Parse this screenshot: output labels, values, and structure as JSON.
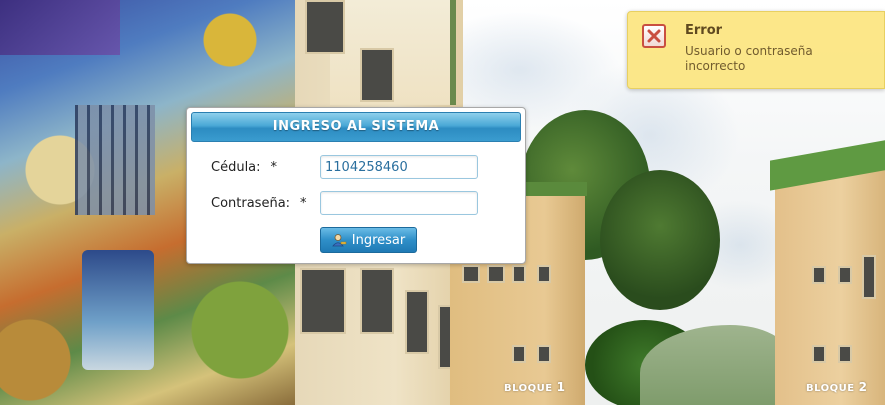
{
  "login": {
    "title": "INGRESO AL SISTEMA",
    "cedula_label": "Cédula:",
    "cedula_required": "*",
    "cedula_value": "1104258460",
    "password_label": "Contraseña:",
    "password_required": "*",
    "password_value": "",
    "submit_label": "Ingresar",
    "submit_icon": "user-login-icon"
  },
  "notification": {
    "type": "error",
    "icon": "error-close-icon",
    "title": "Error",
    "message": "Usuario o contraseña incorrecto"
  },
  "background": {
    "sign_1_word": "BLOQUE",
    "sign_1_number": "1",
    "sign_2_word": "BLOQUE",
    "sign_2_number": "2"
  },
  "colors": {
    "header_blue": "#3a9ccf",
    "toast_yellow": "#fce786",
    "error_red": "#c84a3a",
    "input_text": "#2a6f9e"
  }
}
